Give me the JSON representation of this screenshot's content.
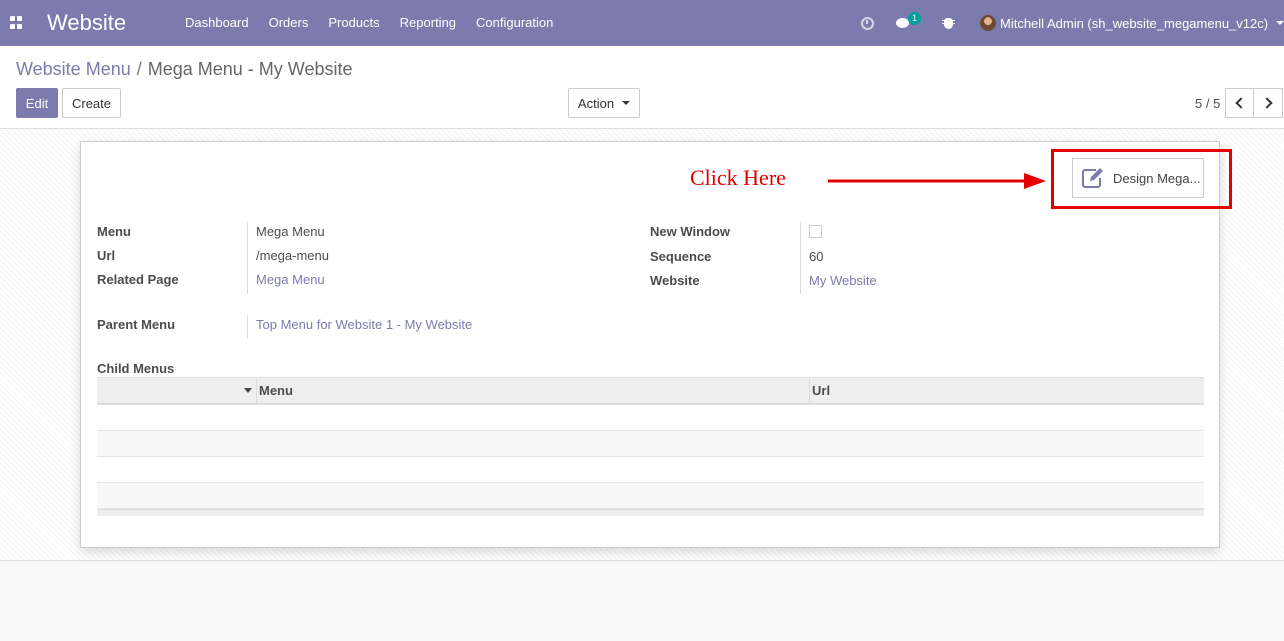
{
  "navbar": {
    "app_title": "Website",
    "menu": [
      "Dashboard",
      "Orders",
      "Products",
      "Reporting",
      "Configuration"
    ],
    "chat_badge": "1",
    "user": "Mitchell Admin (sh_website_megamenu_v12c)",
    "color": "#7c7bad"
  },
  "control": {
    "breadcrumb_parent": "Website Menu",
    "breadcrumb_sep": "/",
    "breadcrumb_current": "Mega Menu - My Website",
    "edit_label": "Edit",
    "create_label": "Create",
    "action_label": "Action",
    "pager": "5 / 5"
  },
  "annotation": {
    "text": "Click Here",
    "color": "#e40000"
  },
  "form": {
    "design_button": "Design Mega...",
    "fields_left": [
      {
        "label": "Menu",
        "value": "Mega Menu"
      },
      {
        "label": "Url",
        "value": "/mega-menu"
      },
      {
        "label": "Related Page",
        "value": "Mega Menu"
      }
    ],
    "fields_right": [
      {
        "label": "New Window",
        "value": ""
      },
      {
        "label": "Sequence",
        "value": "60"
      },
      {
        "label": "Website",
        "value": "My Website"
      }
    ],
    "parent_menu": {
      "label": "Parent Menu",
      "value": "Top Menu for Website 1 - My Website"
    },
    "child_menus": {
      "label": "Child Menus",
      "columns": [
        "Menu",
        "Url"
      ]
    }
  }
}
